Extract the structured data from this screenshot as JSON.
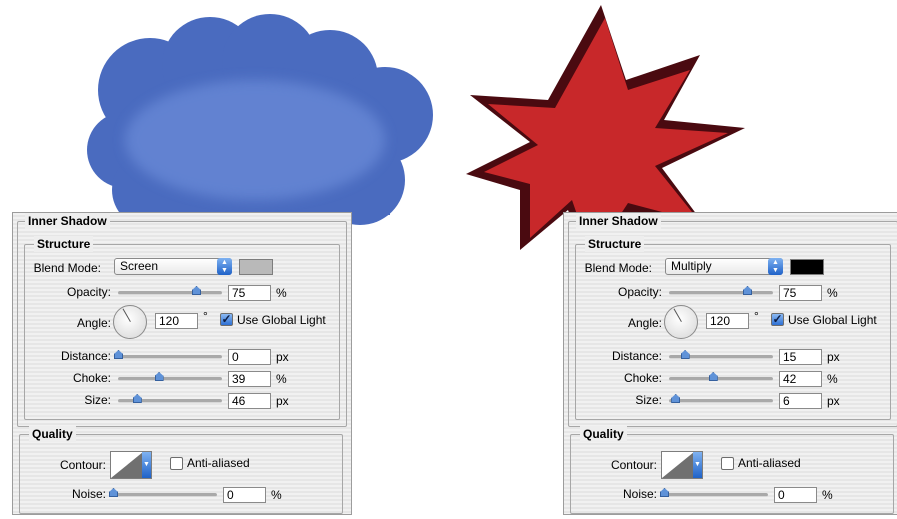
{
  "left_panel": {
    "title": "Inner Shadow",
    "structure_label": "Structure",
    "blend_mode_label": "Blend Mode:",
    "blend_mode_value": "Screen",
    "swatch_color": "#b9b9b9",
    "opacity_label": "Opacity:",
    "opacity_value": "75",
    "opacity_unit": "%",
    "angle_label": "Angle:",
    "angle_value": "120",
    "angle_unit": "°",
    "use_global_light_label": "Use Global Light",
    "use_global_light_checked": true,
    "distance_label": "Distance:",
    "distance_value": "0",
    "distance_unit": "px",
    "choke_label": "Choke:",
    "choke_value": "39",
    "choke_unit": "%",
    "size_label": "Size:",
    "size_value": "46",
    "size_unit": "px",
    "quality_label": "Quality",
    "contour_label": "Contour:",
    "anti_aliased_label": "Anti-aliased",
    "anti_aliased_checked": false,
    "noise_label": "Noise:",
    "noise_value": "0",
    "noise_unit": "%"
  },
  "right_panel": {
    "title": "Inner Shadow",
    "structure_label": "Structure",
    "blend_mode_label": "Blend Mode:",
    "blend_mode_value": "Multiply",
    "swatch_color": "#000000",
    "opacity_label": "Opacity:",
    "opacity_value": "75",
    "opacity_unit": "%",
    "angle_label": "Angle:",
    "angle_value": "120",
    "angle_unit": "°",
    "use_global_light_label": "Use Global Light",
    "use_global_light_checked": true,
    "distance_label": "Distance:",
    "distance_value": "15",
    "distance_unit": "px",
    "choke_label": "Choke:",
    "choke_value": "42",
    "choke_unit": "%",
    "size_label": "Size:",
    "size_value": "6",
    "size_unit": "px",
    "quality_label": "Quality",
    "contour_label": "Contour:",
    "anti_aliased_label": "Anti-aliased",
    "anti_aliased_checked": false,
    "noise_label": "Noise:",
    "noise_value": "0",
    "noise_unit": "%"
  },
  "colors": {
    "cloud_fill": "#4a6bbf",
    "cloud_inner": "#5b7ccc",
    "star_fill": "#c8282a",
    "star_shadow": "#4a0a10",
    "slider_thumb": "#5f92d8"
  },
  "icons": {
    "blend_mode_dropdown": "chevron-updown-icon",
    "contour_dropdown": "chevron-down-icon",
    "angle_dial": "angle-dial-icon",
    "slider": "slider-thumb-icon"
  }
}
